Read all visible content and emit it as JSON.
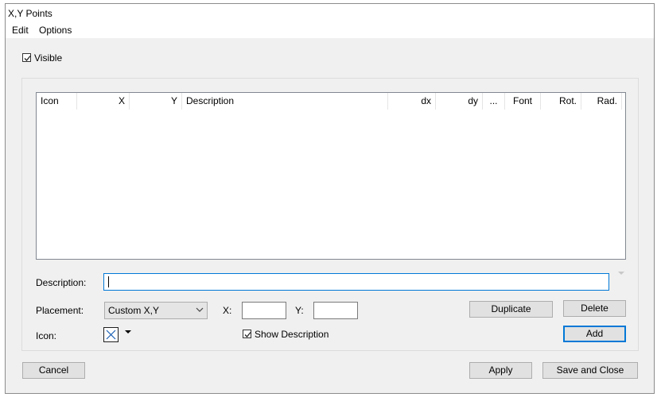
{
  "window": {
    "title": "X,Y Points"
  },
  "menu": {
    "edit": "Edit",
    "options": "Options"
  },
  "visible_checkbox": {
    "label": "Visible",
    "checked": true
  },
  "table": {
    "columns": [
      "Icon",
      "X",
      "Y",
      "Description",
      "dx",
      "dy",
      "...",
      "Font",
      "Rot.",
      "Rad."
    ],
    "rows": []
  },
  "form": {
    "description_label": "Description:",
    "description_value": "",
    "placement_label": "Placement:",
    "placement_value": "Custom X,Y",
    "x_label": "X:",
    "x_value": "",
    "y_label": "Y:",
    "y_value": "",
    "icon_label": "Icon:",
    "show_description_label": "Show Description",
    "show_description_checked": true
  },
  "buttons": {
    "duplicate": "Duplicate",
    "delete": "Delete",
    "add": "Add",
    "cancel": "Cancel",
    "apply": "Apply",
    "save_close": "Save and Close"
  },
  "colors": {
    "accent": "#0078d7",
    "dialog_bg": "#f0f0f0"
  }
}
